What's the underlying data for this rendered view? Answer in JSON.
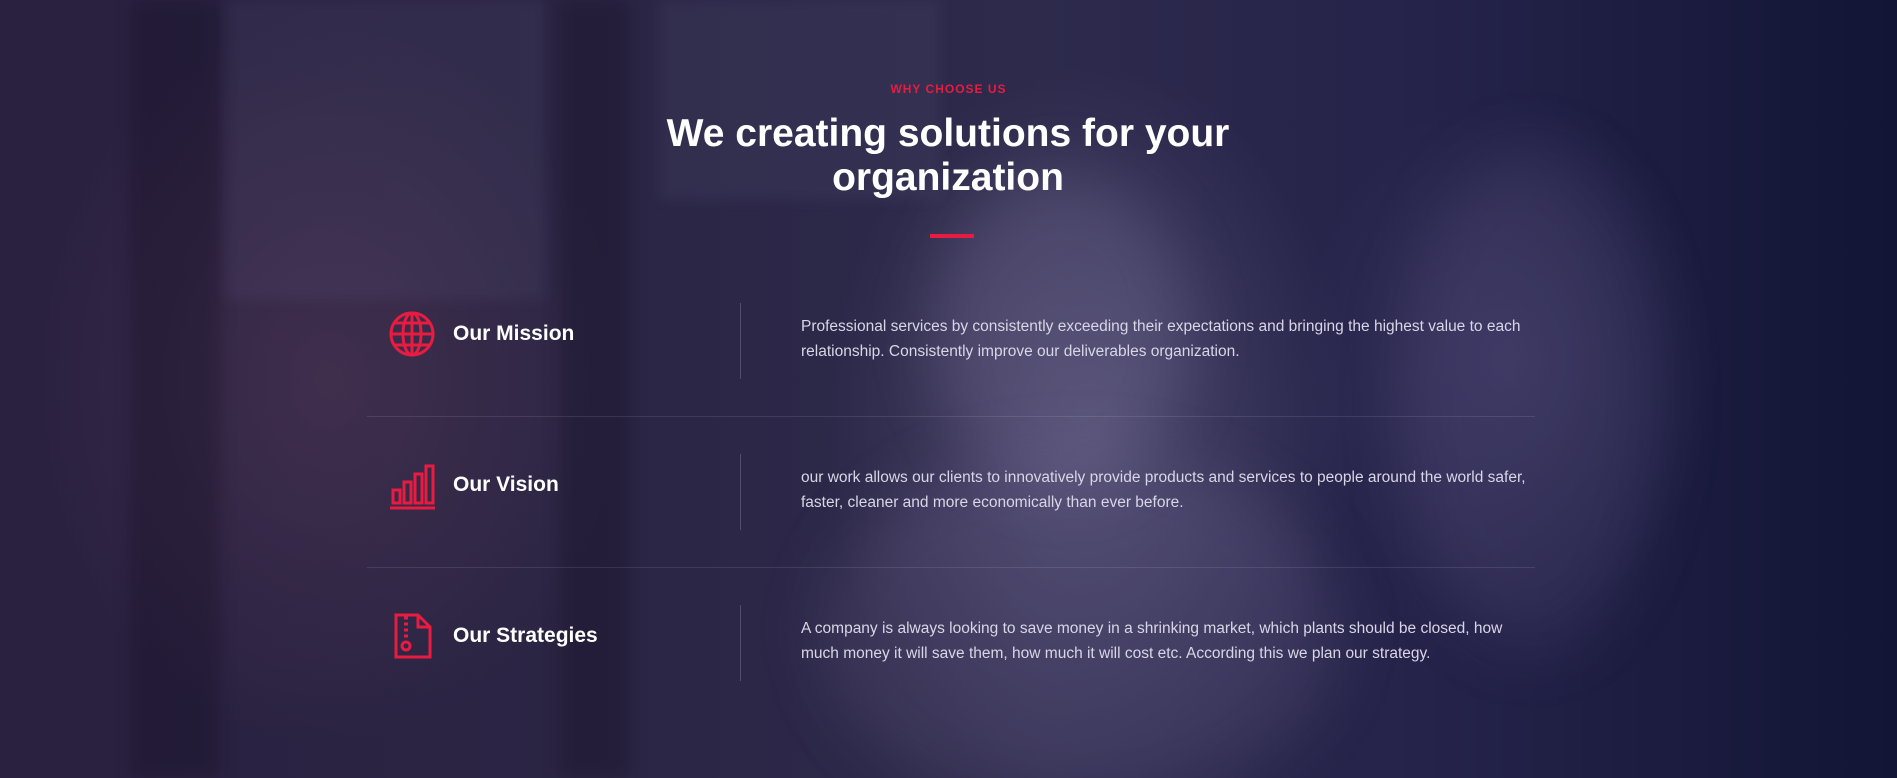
{
  "section": {
    "eyebrow": "WHY CHOOSE US",
    "title": "We creating solutions for your organization"
  },
  "features": [
    {
      "icon": "globe-icon",
      "title": "Our Mission",
      "text": "Professional services by consistently exceeding their expectations and bringing the highest value to each relationship. Consistently improve our deliverables organization."
    },
    {
      "icon": "bar-chart-icon",
      "title": "Our Vision",
      "text": "our work allows our clients to innovatively provide products and services to people around the world safer, faster, cleaner and more economically than ever before."
    },
    {
      "icon": "document-zipper-icon",
      "title": "Our Strategies",
      "text": "A company is always looking to save money in a shrinking market, which plants should be closed, how much money it will save them, how much it will cost etc. According this we plan our strategy."
    }
  ],
  "colors": {
    "accent": "#e81b41",
    "overlay": "#2b2748",
    "text": "#ffffff",
    "body_text": "#d8d6e6"
  }
}
